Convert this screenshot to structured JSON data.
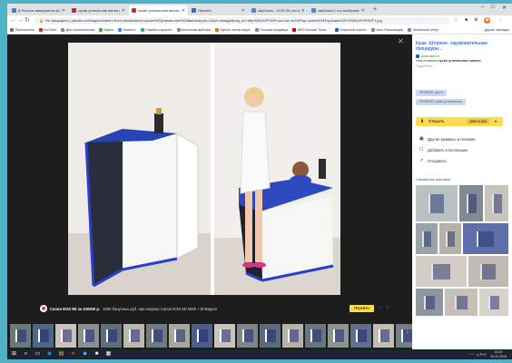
{
  "tabs": [
    {
      "label": "В России завершился рост числ",
      "color": "#4a7bd4"
    },
    {
      "label": "сухая углекислая ванна yandex",
      "color": "#d7262c"
    },
    {
      "label": "сухие углекислые ванны разиб",
      "color": "#d7262c",
      "active": true
    },
    {
      "label": "HeadHu",
      "color": "#3d6bb5"
    },
    {
      "label": "зарбонга – EOS 5D тех изображен",
      "color": "#4a86e8"
    },
    {
      "label": "зарбонга 1 гос изображений та",
      "color": "#4a86e8"
    }
  ],
  "newtab_label": "+",
  "window_controls": [
    "–",
    "□",
    "✕"
  ],
  "address": {
    "lock": "🔒",
    "prefix": "Не защищено",
    "url": "yandex.ru/images/search?from=tabbar&text=сухие%20углекислые%20ванны&pos=1&rpt=simage&img_url=http%3A%2F%2Fnovi-osn.ru%2Fwp-content%2Fuploads%2F2018%2F09%2F1.jpg"
  },
  "nav": {
    "back": "←",
    "forward": "→",
    "reload": "↻"
  },
  "toolbar_icons": [
    "☆",
    "■",
    "⊞",
    "◉",
    "⋮"
  ],
  "bookmarks": [
    {
      "label": "Приложения",
      "color": "#777"
    },
    {
      "label": "YouTube",
      "color": "#e62117"
    },
    {
      "label": "Для строительства",
      "color": "#888"
    },
    {
      "label": "Карты",
      "color": "#34a853"
    },
    {
      "label": "Новости",
      "color": "#4285f4"
    },
    {
      "label": "Службы слухиста",
      "color": "#3a9"
    },
    {
      "label": "Биологика арбитра",
      "color": "#888"
    },
    {
      "label": "Купить чехлы наруч",
      "color": "#e37400"
    },
    {
      "label": "Получка продавца",
      "color": "#888"
    },
    {
      "label": "HBO Москва \"Боль...\"",
      "color": "#c00"
    },
    {
      "label": "Открытый портал",
      "color": "#1565c0"
    },
    {
      "label": "Чехл Пятиканциф",
      "color": "#888"
    },
    {
      "label": "Легальный алеут",
      "color": "#888"
    }
  ],
  "other_bookmarks": "Другие закладки",
  "viewer": {
    "close": "✕",
    "caption_owner": "Canon EOS 5D за 100000 р.",
    "caption_text": "1000 бонусных руб. при покупке Canon EOS 5D Mark + М-Видео!",
    "goto_label": "Перейти",
    "more": "⋯",
    "next": "›",
    "filmstrip_colors": [
      "#6a7a7a",
      "#4f6782",
      "#c8c2b8",
      "#8a8f92",
      "#5d6f78",
      "#bdb7ae",
      "#6f7b80",
      "#a6a8a0",
      "#4f5d8a",
      "#c9c3bb",
      "#7c8588",
      "#5a6b7a",
      "#b8b1a8",
      "#6b7580",
      "#8f958f",
      "#5e6f86",
      "#c2bcb3",
      "#747f84"
    ]
  },
  "panel": {
    "title": "Кушк. Шторное, оздоровительные процедуры...",
    "site": "novi-osn.ru",
    "desc_prefix": "Чем полезны",
    "desc_bold": "сухие углекислые ванны",
    "more": "Подробнее",
    "chip1": "РЕЗЛЕКС фото",
    "chip2": "РЕЗЛЕКС сухие углекислые",
    "open_label": "Открыть",
    "size": "1000×1343",
    "actions": [
      {
        "icon": "▣",
        "label": "Другие размеры и похожие"
      },
      {
        "icon": "☐",
        "label": "Добавить в коллекцию"
      },
      {
        "icon": "↗",
        "label": "Отправить"
      }
    ],
    "similar_title": "Связанные картинки"
  },
  "taskbar": {
    "icons": [
      "⊞",
      "⌕",
      "▭",
      "◉",
      "▤",
      "●",
      "◆",
      "■",
      "▦"
    ],
    "tray": "^ ⌃ ◁) РУС",
    "time": "15:42",
    "date": "25.10.2018"
  }
}
